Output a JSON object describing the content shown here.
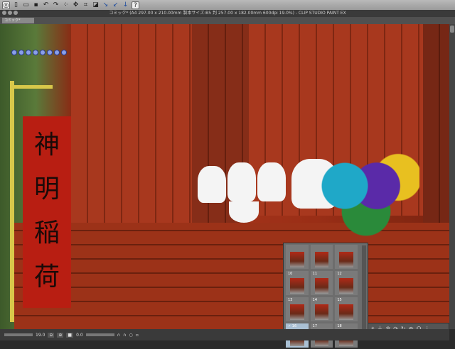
{
  "toolbar": {
    "icons": [
      "clip-studio-icon",
      "new-icon",
      "open-icon",
      "save-icon",
      "undo-icon",
      "redo-icon",
      "transform-icon",
      "help-icon"
    ]
  },
  "title": "コミック* (A4 297.00 x 210.00mm 製本サイズ:B5 判 257.00 x 182.00mm 600dpi 19.0%) - CLIP STUDIO PAINT EX",
  "tab": "コミック*",
  "banner": {
    "chars": [
      "神",
      "明",
      "稲",
      "荷"
    ]
  },
  "materials": {
    "items": [
      {
        "n": ""
      },
      {
        "n": ""
      },
      {
        "n": ""
      },
      {
        "n": "10"
      },
      {
        "n": "11"
      },
      {
        "n": "12"
      },
      {
        "n": "13"
      },
      {
        "n": "14"
      },
      {
        "n": "15"
      },
      {
        "n": "✓ 16",
        "selected": true
      },
      {
        "n": "17"
      },
      {
        "n": "18"
      }
    ]
  },
  "status": {
    "zoom": "19.0",
    "angle": "0.0"
  }
}
